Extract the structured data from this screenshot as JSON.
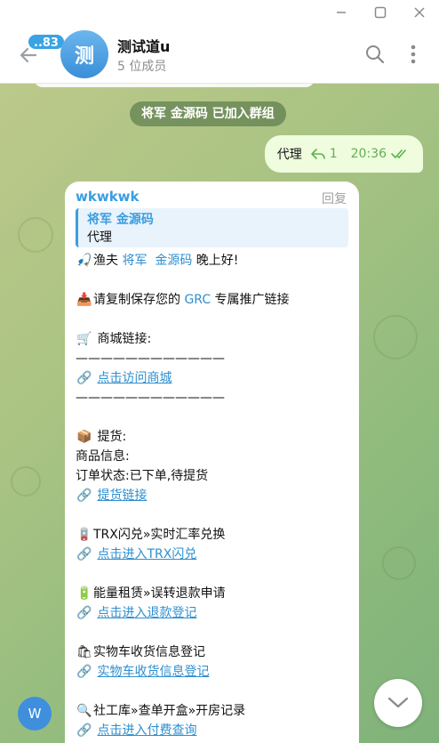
{
  "window": {
    "min_icon": "minimize-icon",
    "max_icon": "maximize-icon",
    "close_icon": "close-icon"
  },
  "header": {
    "unread_badge": "..83",
    "avatar_letter": "测",
    "title": "测试道u",
    "subtitle": "5 位成员"
  },
  "service_message": "将军 金源码 已加入群组",
  "outgoing": {
    "text": "代理",
    "reply_count": "1",
    "time": "20:36"
  },
  "incoming": {
    "sender": "wkwkwk",
    "reply_label": "回复",
    "quote_name": "将军 金源码",
    "quote_text": "代理",
    "greeting_prefix": "渔夫 ",
    "greeting_name1": "将军",
    "greeting_name2": "金源码",
    "greeting_suffix": " 晚上好!",
    "copy_prefix": "请复制保存您的 ",
    "copy_grc": "GRC",
    "copy_suffix": " 专属推广链接",
    "mall_label": " 商城链接:",
    "divider": "————————————",
    "mall_link": "点击访问商城",
    "pickup_label": " 提货:",
    "product_info": "商品信息:",
    "order_status": "订单状态:已下单,待提货",
    "pickup_link": "提货链接",
    "trx_label": "TRX闪兑»实时汇率兑换",
    "trx_link": "点击进入TRX闪兑",
    "energy_label": "能量租赁»误转退款申请",
    "energy_link": "点击进入退款登记",
    "goods_label": "实物车收货信息登记",
    "goods_link": "实物车收货信息登记",
    "social_label": "社工库»查单开盒»开房记录",
    "social_link": "点击进入付费查询"
  },
  "fab_letter": "W"
}
